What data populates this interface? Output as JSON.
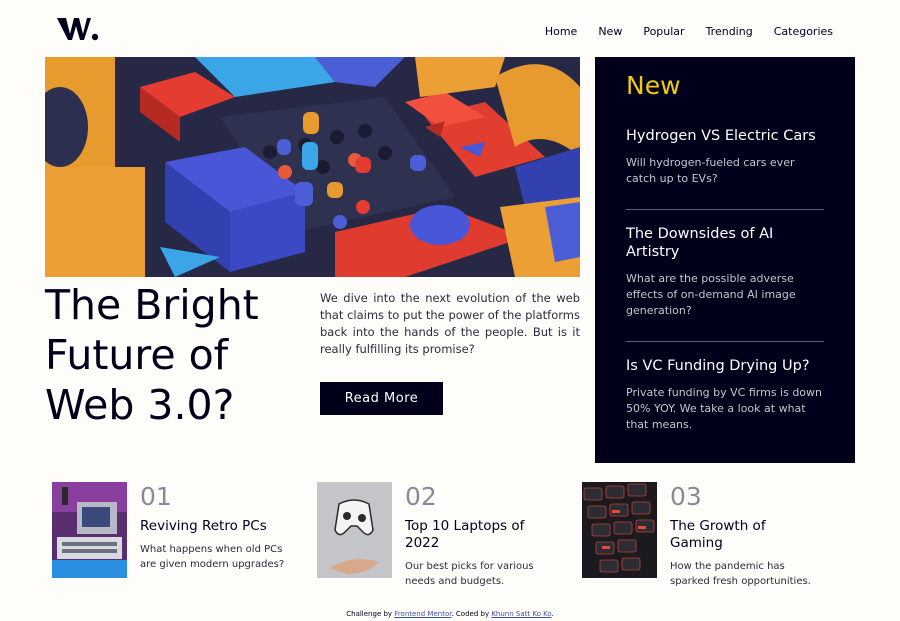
{
  "header": {
    "logo_text": "W.",
    "nav": [
      "Home",
      "New",
      "Popular",
      "Trending",
      "Categories"
    ]
  },
  "hero": {
    "title": "The Bright Future of Web 3.0?",
    "lead": "We dive into the next evolution of the web that claims to put the power of the platforms back into the hands of the people. But is it really fulfilling its promise?",
    "button_label": "Read More"
  },
  "new_panel": {
    "title": "New",
    "items": [
      {
        "title": "Hydrogen VS Electric Cars",
        "description": "Will hydrogen-fueled cars ever catch up to EVs?"
      },
      {
        "title": "The Downsides of AI Artistry",
        "description": "What are the possible adverse effects of on-demand AI image generation?"
      },
      {
        "title": "Is VC Funding Drying Up?",
        "description": "Private funding by VC firms is down 50% YOY. We take a look at what that means."
      }
    ]
  },
  "cards": [
    {
      "number": "01",
      "title": "Reviving Retro PCs",
      "description": "What happens when old PCs are given modern upgrades?"
    },
    {
      "number": "02",
      "title": "Top 10 Laptops of 2022",
      "description": "Our best picks for various needs and budgets."
    },
    {
      "number": "03",
      "title": "The Growth of Gaming",
      "description": "How the pandemic has sparked fresh opportunities."
    }
  ],
  "footer": {
    "prefix": "Challenge by",
    "link1": "Frontend Mentor",
    "middle": ". Coded by",
    "link2": "Khunn Satt Ko Ko",
    "suffix": "."
  },
  "colors": {
    "dark_navy": "#00001a",
    "accent_yellow": "#f2c811",
    "off_white": "#fffdfa"
  }
}
